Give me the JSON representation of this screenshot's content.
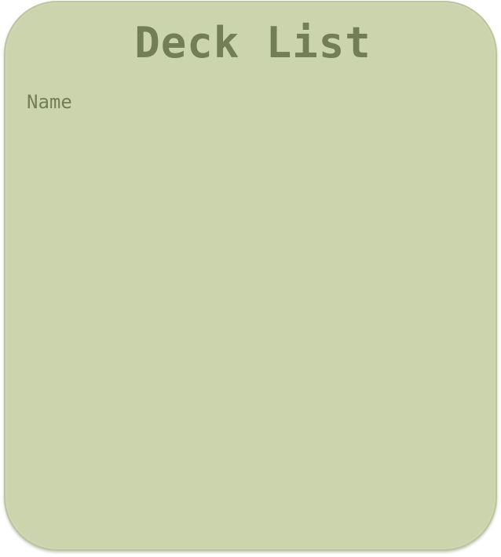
{
  "deck_list": {
    "title": "Deck List",
    "columns": {
      "name": "Name"
    },
    "items": []
  },
  "colors": {
    "panel_background": "#ccd4ae",
    "panel_border": "#bcc59f",
    "text": "#747e56"
  }
}
